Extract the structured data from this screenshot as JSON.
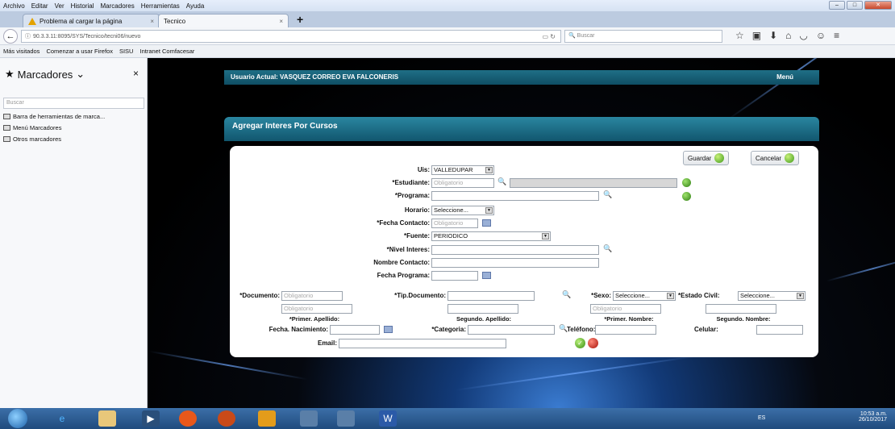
{
  "menubar": {
    "items": [
      "Archivo",
      "Editar",
      "Ver",
      "Historial",
      "Marcadores",
      "Herramientas",
      "Ayuda"
    ]
  },
  "tabs": [
    {
      "label": "Problema al cargar la página",
      "close": "×"
    },
    {
      "label": "Tecnico",
      "close": "×"
    }
  ],
  "newtab": "+",
  "nav": {
    "url": "90.3.3.11:8095/SYS/Tecnico/tecni06/nuevo",
    "search_placeholder": "Buscar"
  },
  "bookmarks": {
    "items": [
      "Más visitados",
      "Comenzar a usar Firefox",
      "SISU",
      "Intranet Comfacesar"
    ]
  },
  "sidebar": {
    "title": "Marcadores",
    "close": "×",
    "search_placeholder": "Buscar",
    "items": [
      "Barra de herramientas de marca...",
      "Menú Marcadores",
      "Otros marcadores"
    ]
  },
  "app": {
    "user_label": "Usuario Actual: VASQUEZ CORREO EVA FALCONERIS",
    "menu": "Menú",
    "panel_title": "Agregar Interes Por Cursos",
    "save": "Guardar",
    "cancel": "Cancelar"
  },
  "form": {
    "uis_label": "Uis:",
    "uis_value": "VALLEDUPAR",
    "estudiante_label": "*Estudiante:",
    "estudiante_placeholder": "Obligatorio",
    "programa_label": "*Programa:",
    "horario_label": "Horario:",
    "horario_value": "Seleccione...",
    "fecha_contacto_label": "*Fecha Contacto:",
    "fecha_contacto_placeholder": "Obligatorio",
    "fuente_label": "*Fuente:",
    "fuente_value": "PERIODICO",
    "nivel_interes_label": "*Nivel Interes:",
    "nombre_contacto_label": "Nombre Contacto:",
    "fecha_programa_label": "Fecha Programa:",
    "documento_label": "*Documento:",
    "documento_placeholder": "Obligatorio",
    "tip_documento_label": "*Tip.Documento:",
    "sexo_label": "*Sexo:",
    "sexo_value": "Seleccione...",
    "estado_civil_label": "*Estado Civil:",
    "estado_civil_value": "Seleccione...",
    "primer_apellido_placeholder": "Obligatorio",
    "primer_nombre_placeholder": "Obligatorio",
    "primer_apellido_label": "*Primer. Apellido:",
    "segundo_apellido_label": "Segundo. Apellido:",
    "primer_nombre_label": "*Primer. Nombre:",
    "segundo_nombre_label": "Segundo. Nombre:",
    "fecha_nacimiento_label": "Fecha. Nacimiento:",
    "categoria_label": "*Categoria:",
    "telefono_label": "Teléfono:",
    "celular_label": "Celular:",
    "email_label": "Email:"
  },
  "tray": {
    "lang": "ES",
    "time": "10:53 a.m.",
    "date": "26/10/2017"
  }
}
